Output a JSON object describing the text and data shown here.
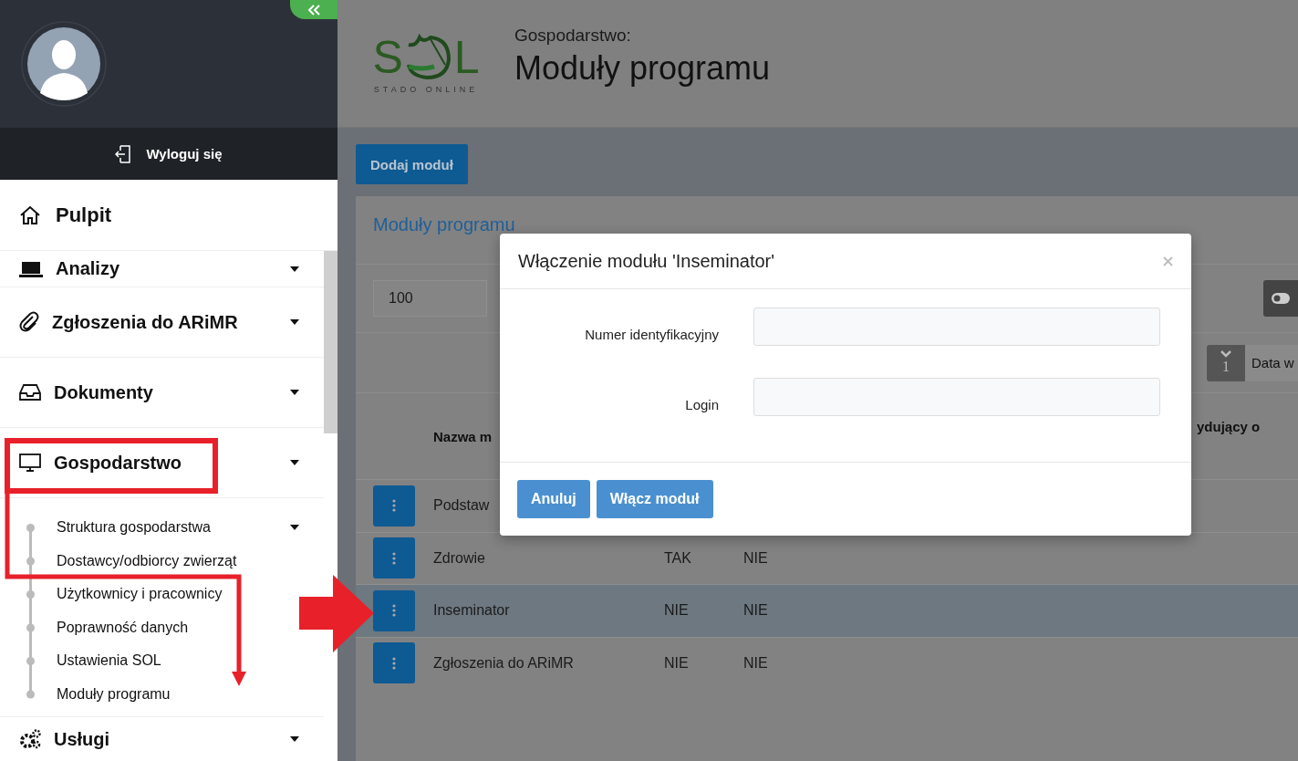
{
  "sidebar": {
    "logout": "Wyloguj się",
    "home": "Pulpit",
    "menu": [
      {
        "label": "Analizy"
      },
      {
        "label": "Zgłoszenia do ARiMR"
      },
      {
        "label": "Dokumenty"
      },
      {
        "label": "Gospodarstwo",
        "children": [
          {
            "label": "Struktura gospodarstwa",
            "submenu": true
          },
          {
            "label": "Dostawcy/odbiorcy zwierząt",
            "submenu": false
          },
          {
            "label": "Użytkownicy i pracownicy",
            "submenu": false
          },
          {
            "label": "Poprawność danych",
            "submenu": false
          },
          {
            "label": "Ustawienia SOL",
            "submenu": false
          },
          {
            "label": "Moduły programu",
            "submenu": false
          }
        ]
      },
      {
        "label": "Usługi"
      }
    ]
  },
  "header": {
    "logo": {
      "first": "S",
      "last": "L",
      "tagline": "STADO ONLINE"
    },
    "section": "Gospodarstwo:",
    "title": "Moduły programu"
  },
  "toolbar": {
    "add_button": "Dodaj moduł"
  },
  "panel": {
    "title": "Moduły programu",
    "page_size": "100",
    "sort_badge": "1",
    "sort_label": "Data w",
    "columns": [
      "Nazwa m",
      "ydujący o"
    ],
    "rows": [
      {
        "name": "Podstaw",
        "selected": false
      },
      {
        "name": "Zdrowie",
        "values": [
          "TAK",
          "NIE"
        ],
        "selected": false
      },
      {
        "name": "Inseminator",
        "values": [
          "NIE",
          "NIE"
        ],
        "selected": true
      },
      {
        "name": "Zgłoszenia do ARiMR",
        "values": [
          "NIE",
          "NIE"
        ],
        "selected": false
      }
    ]
  },
  "modal": {
    "title": "Włączenie modułu 'Inseminator'",
    "fields": [
      {
        "label": "Numer identyfikacyjny"
      },
      {
        "label": "Login"
      }
    ],
    "buttons": [
      "Anuluj",
      "Włącz moduł"
    ]
  }
}
